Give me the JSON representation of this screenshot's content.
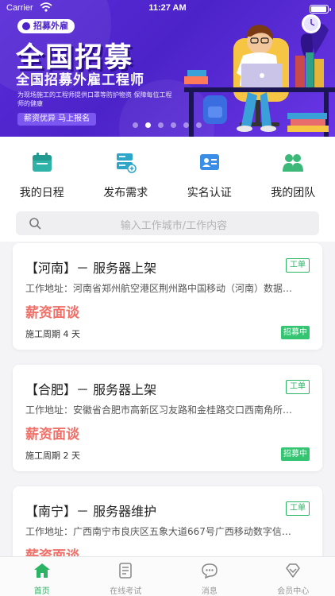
{
  "status_bar": {
    "carrier": "Carrier",
    "time": "11:27 AM",
    "battery_level": 1.0
  },
  "banner": {
    "tag": "招募外雇",
    "title": "全国招募",
    "subtitle": "全国招募外雇工程师",
    "description": "为现场施工的工程师提供口罩等防护物资 保障每位工程师的健康",
    "cta": "薪资优异 马上报名",
    "dot_count": 6,
    "active_dot": 1,
    "colors": {
      "bg": "#4c23c9",
      "accent": "#ffffff"
    }
  },
  "quick_actions": [
    {
      "label": "我的日程",
      "icon": "calendar-icon"
    },
    {
      "label": "发布需求",
      "icon": "server-add-icon"
    },
    {
      "label": "实名认证",
      "icon": "id-card-icon"
    },
    {
      "label": "我的团队",
      "icon": "team-icon"
    }
  ],
  "search": {
    "placeholder": "输入工作城市/工作内容"
  },
  "jobs": [
    {
      "title": "【河南】－ 服务器上架",
      "badge": "工单",
      "address": "工作地址：河南省郑州航空港区荆州路中国移动（河南）数据中心",
      "salary": "薪资面谈",
      "period": "施工周期 4 天",
      "status": "招募中"
    },
    {
      "title": "【合肥】－ 服务器上架",
      "badge": "工单",
      "address": "工作地址：安徽省合肥市高新区习友路和金桂路交口西南角所需设备",
      "salary": "薪资面谈",
      "period": "施工周期 2 天",
      "status": "招募中"
    },
    {
      "title": "【南宁】－ 服务器维护",
      "badge": "工单",
      "address": "工作地址：广西南宁市良庆区五象大道667号广西移动数字信息中心",
      "salary": "薪资面谈",
      "period": "",
      "status": ""
    }
  ],
  "tabbar": {
    "tabs": [
      {
        "label": "首页",
        "icon": "home-icon",
        "active": true
      },
      {
        "label": "在线考试",
        "icon": "exam-icon",
        "active": false
      },
      {
        "label": "消息",
        "icon": "message-icon",
        "active": false
      },
      {
        "label": "会员中心",
        "icon": "member-icon",
        "active": false
      }
    ]
  },
  "colors": {
    "primary_green": "#2ab464",
    "salary_red": "#f07069",
    "page_bg": "#f4f4f6"
  }
}
